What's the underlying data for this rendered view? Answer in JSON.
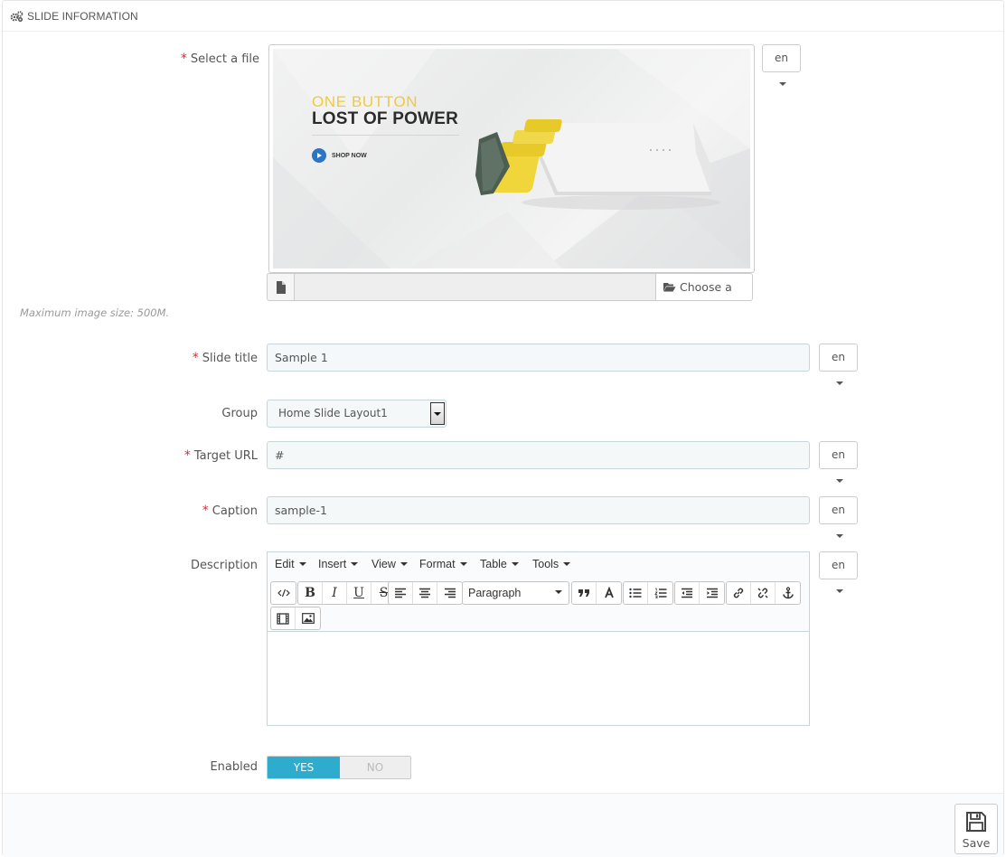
{
  "panel": {
    "title": "SLIDE INFORMATION",
    "icon": "cogs-icon"
  },
  "form": {
    "file": {
      "label": "Select a file",
      "required": "*",
      "lang": "en",
      "choose_label": "Choose a file",
      "help": "Maximum image size: 500M.",
      "preview": {
        "line1": "ONE BUTTON",
        "line2": "LOST OF POWER",
        "cta": "SHOP NOW"
      }
    },
    "slide_title": {
      "label": "Slide title",
      "required": "*",
      "value": "Sample 1",
      "lang": "en"
    },
    "group": {
      "label": "Group",
      "value": "Home Slide Layout1"
    },
    "target_url": {
      "label": "Target URL",
      "required": "*",
      "value": "#",
      "lang": "en"
    },
    "caption": {
      "label": "Caption",
      "required": "*",
      "value": "sample-1",
      "lang": "en"
    },
    "description": {
      "label": "Description",
      "lang": "en",
      "menus": [
        "Edit",
        "Insert",
        "View",
        "Format",
        "Table",
        "Tools"
      ],
      "block_format": "Paragraph"
    },
    "enabled": {
      "label": "Enabled",
      "yes": "YES",
      "no": "NO",
      "value": "YES"
    }
  },
  "footer": {
    "save_label": "Save"
  },
  "colors": {
    "required": "#e3282e",
    "switch_on": "#2eacce",
    "banner_accent": "#f2c93d"
  }
}
